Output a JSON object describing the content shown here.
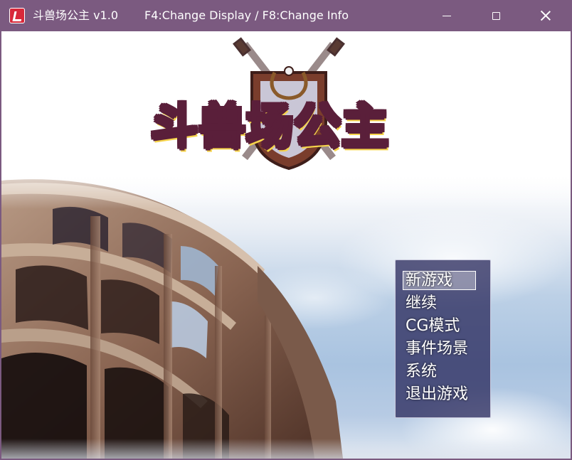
{
  "window": {
    "title": "斗兽场公主 v1.0",
    "info": "F4:Change Display / F8:Change Info",
    "titlebar_color": "#7b5a80",
    "icon": "app-icon",
    "controls": {
      "minimize_icon": "minimize-icon",
      "maximize_icon": "maximize-icon",
      "close_icon": "close-icon"
    }
  },
  "game": {
    "logo_text": "斗兽场公主",
    "logo_emblem": "crossed-swords-shield-laurel-icon",
    "background": "colosseum-under-sky",
    "menu": {
      "items": [
        {
          "label": "新游戏",
          "selected": true
        },
        {
          "label": "继续",
          "selected": false
        },
        {
          "label": "CG模式",
          "selected": false
        },
        {
          "label": "事件场景",
          "selected": false
        },
        {
          "label": "系统",
          "selected": false
        },
        {
          "label": "退出游戏",
          "selected": false
        }
      ],
      "background_color": "#2d2d5f"
    }
  }
}
